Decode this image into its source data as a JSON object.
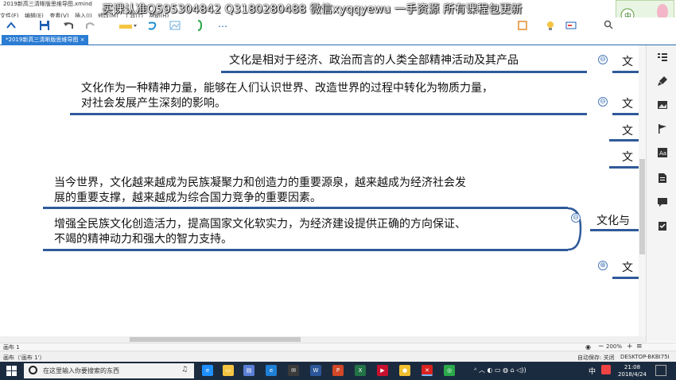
{
  "window": {
    "title": "2019新高三清晰版思维导图.xmind",
    "watermark": "买课认准Q595304842 Q3180280488 微信xyqqyewu 一手资源 所有课程包更新"
  },
  "menu": [
    "文件(F)",
    "编辑(E)",
    "查看(V)",
    "插入(I)",
    "修改(M)",
    "工具(T)",
    "帮助(H)"
  ],
  "tab": {
    "label": "*2019新高三清晰版思维导图",
    "close": "×"
  },
  "topics": {
    "t1": "文化是相对于经济、政治而言的人类全部精神活动及其产品",
    "t2a": "文化作为一种精神力量，能够在人们认识世界、改造世界的过程中转化为物质力量，",
    "t2b": "对社会发展产生深刻的影响。",
    "t3a": "当今世界，文化越来越成为民族凝聚力和创造力的重要源泉，越来越成为经济社会发",
    "t3b": "展的重要支撑，越来越成为综合国力竞争的重要因素。",
    "t4a": "增强全民族文化创造活力，提高国家文化软实力，为经济建设提供正确的方向保证、",
    "t4b": "不竭的精神动力和强大的智力支持。",
    "r1": "文",
    "r2": "文",
    "r3": "文",
    "r4": "文",
    "r5": "文化与",
    "r6": "文"
  },
  "collapse": {
    "minus": "⊖",
    "plus": "⊕"
  },
  "sheet": {
    "name": "画布 1",
    "status": "画布（'画布 1'）"
  },
  "zoom": {
    "label": "200%",
    "minus": "−",
    "plus": "+"
  },
  "statusRight": {
    "autosave": "自动保存: 关闭",
    "user": "DESKTOP-BKBI75I"
  },
  "taskbar": {
    "search_placeholder": "在这里输入你要搜索的东西",
    "time": "21:08",
    "date": "2018/4/24",
    "ime": "中"
  }
}
